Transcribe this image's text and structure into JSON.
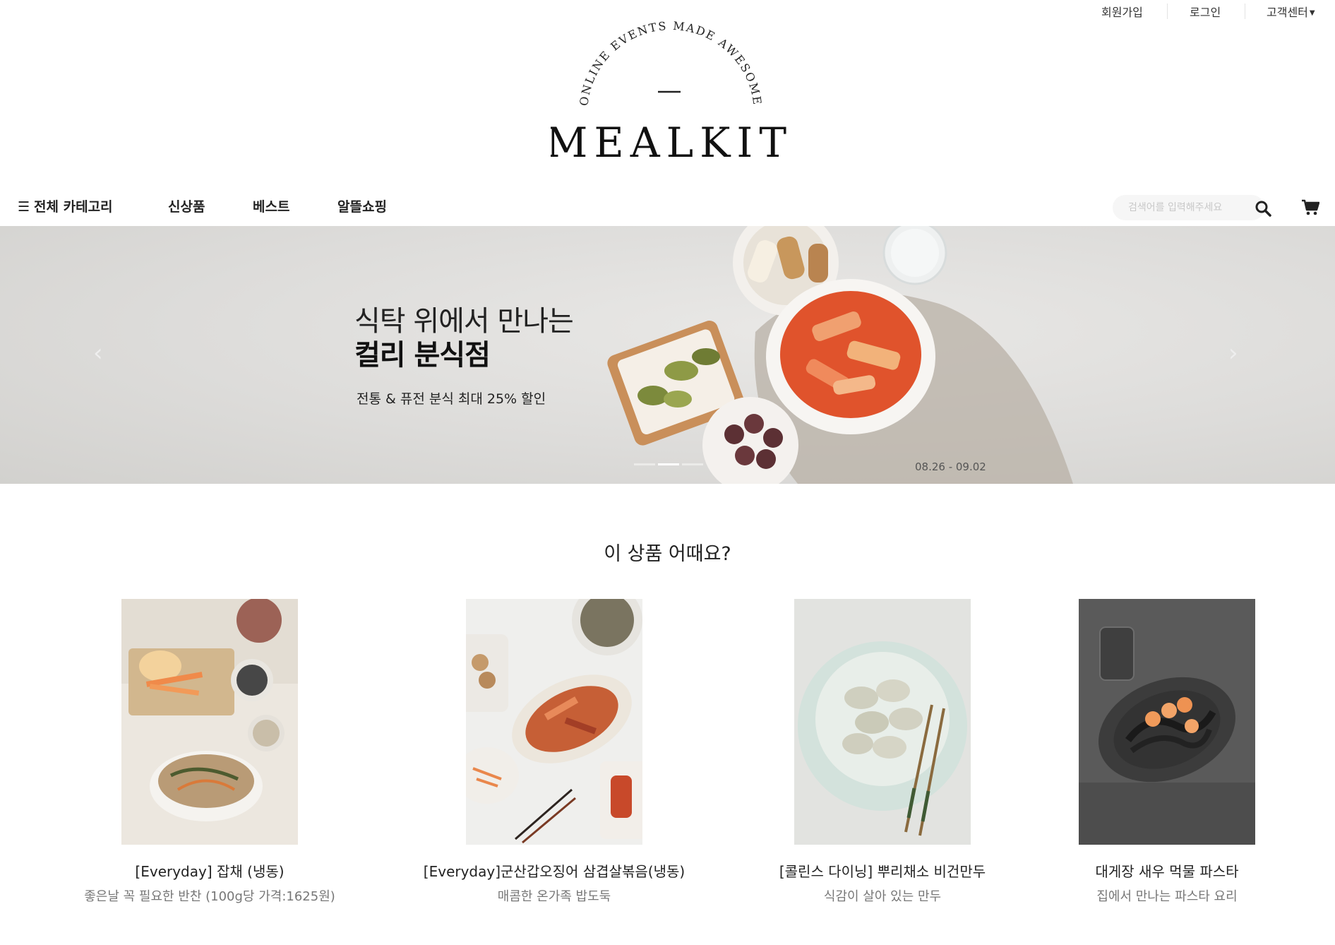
{
  "utility": {
    "signup": "회원가입",
    "login": "로그인",
    "support": "고객센터"
  },
  "logo": {
    "arc_text": "ONLINE EVENTS MADE AWESOME",
    "brand": "MEALKIT"
  },
  "nav": {
    "all_categories": "전체 카테고리",
    "new": "신상품",
    "best": "베스트",
    "deals": "알뜰쇼핑"
  },
  "search": {
    "placeholder": "검색어를 입력해주세요"
  },
  "banner": {
    "line1": "식탁 위에서 만나는",
    "line2": "컬리 분식점",
    "subtitle": "전통 & 퓨전 분식 최대 25% 할인",
    "date": "08.26 - 09.02",
    "prev_symbol": "‹",
    "next_symbol": "›",
    "slide_count": 3,
    "active_slide": 2
  },
  "section": {
    "title": "이 상품 어때요?"
  },
  "products": [
    {
      "name": "[Everyday] 잡채 (냉동)",
      "desc": "좋은날 꼭 필요한 반찬 (100g당 가격:1625원)"
    },
    {
      "name": "[Everyday]군산갑오징어 삼겹살볶음(냉동)",
      "desc": "매콤한 온가족 밥도둑"
    },
    {
      "name": "[콜린스 다이닝] 뿌리채소 비건만두",
      "desc": "식감이 살아 있는 만두"
    },
    {
      "name": "대게장 새우 먹물 파스타",
      "desc": "집에서 만나는 파스타 요리"
    }
  ],
  "colors": {
    "text": "#222222",
    "muted": "#777777",
    "banner_bg": "#dddcda",
    "search_bg": "#f6f6f6"
  },
  "icons": {
    "menu": "hamburger-icon",
    "search": "search-icon",
    "cart": "cart-icon",
    "dropdown": "caret-down-icon"
  }
}
